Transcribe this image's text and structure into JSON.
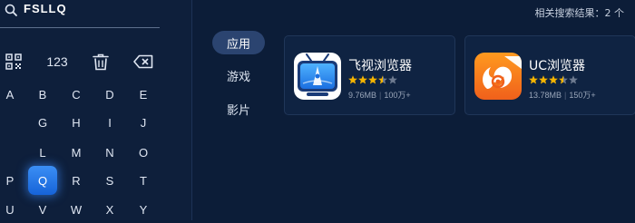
{
  "search": {
    "query": "FSLLQ"
  },
  "keyboard": {
    "numbers_label": "123",
    "rows": [
      [
        "A",
        "B",
        "C",
        "D",
        "E"
      ],
      [
        "G",
        "H",
        "I",
        "J"
      ],
      [
        "L",
        "M",
        "N",
        "O"
      ],
      [
        "P",
        "Q",
        "R",
        "S",
        "T"
      ],
      [
        "U",
        "V",
        "W",
        "X",
        "Y"
      ]
    ],
    "selected_key": "Q"
  },
  "categories": [
    {
      "label": "应用",
      "active": true
    },
    {
      "label": "游戏",
      "active": false
    },
    {
      "label": "影片",
      "active": false
    }
  ],
  "result_count": "相关搜索结果：2 个",
  "results": [
    {
      "name": "飞视浏览器",
      "rating": 3.5,
      "size": "9.76MB",
      "downloads": "100万+",
      "icon": "tv-browser-icon"
    },
    {
      "name": "UC浏览器",
      "rating": 3.5,
      "size": "13.78MB",
      "downloads": "150万+",
      "icon": "uc-squirrel-icon"
    }
  ],
  "colors": {
    "background": "#0c1d38",
    "selected_key": "#1f73e8",
    "star_filled": "#f5b400",
    "star_empty": "#6d7a90"
  }
}
